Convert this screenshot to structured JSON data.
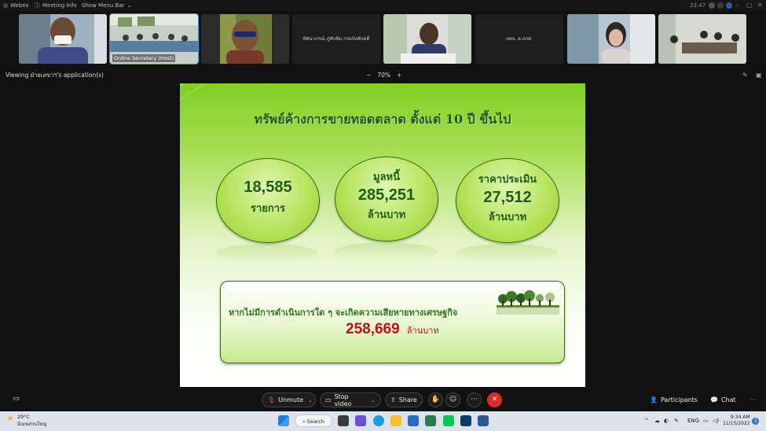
{
  "topbar": {
    "app_name": "Webex",
    "meeting_info": "Meeting Info",
    "show_menu_bar": "Show Menu Bar",
    "time": "23:47"
  },
  "participants_strip": {
    "tiles": [
      {
        "caption": ""
      },
      {
        "caption": "",
        "host_label": "Online Secretary (Host)"
      },
      {
        "caption": ""
      },
      {
        "caption": "ทัศนาภรณ์ ภู่ทับทิม กรมบังคับคดี"
      },
      {
        "caption": ""
      },
      {
        "caption": "บคจ. ผ.ภกศ."
      },
      {
        "caption": ""
      },
      {
        "caption": ""
      }
    ]
  },
  "view_bar": {
    "viewing_text": "Viewing ฝ่ายเลขาฯ's application(s)",
    "zoom_minus": "−",
    "zoom_level": "70%",
    "zoom_plus": "+"
  },
  "slide": {
    "title": "ทรัพย์ค้างการขายทอดตลาด ตั้งแต่ 10 ปี ขึ้นไป",
    "stats": [
      {
        "label": "",
        "value": "18,585",
        "unit": "รายการ"
      },
      {
        "label": "มูลหนี้",
        "value": "285,251",
        "unit": "ล้านบาท"
      },
      {
        "label": "ราคาประเมิน",
        "value": "27,512",
        "unit": "ล้านบาท"
      }
    ],
    "note": "หากไม่มีการดำเนินการใด ๆ จะเกิดความเสียหายทางเศรษฐกิจ",
    "loss_value": "258,669",
    "loss_unit": "ล้านบาท"
  },
  "controls": {
    "unmute": "Unmute",
    "stop_video": "Stop video",
    "share": "Share",
    "more": "···",
    "participants": "Participants",
    "chat": "Chat"
  },
  "taskbar": {
    "temp": "29°C",
    "weather_desc": "มีเมฆส่วนใหญ่",
    "search": "Search",
    "lang": "ENG",
    "time": "9:34 AM",
    "date": "11/15/2022",
    "notifications": "3"
  },
  "colors": {
    "slide_green": "#8fd43a",
    "title_green": "#1e5a18",
    "loss_red": "#c0101a",
    "end_red": "#e02b2b"
  }
}
